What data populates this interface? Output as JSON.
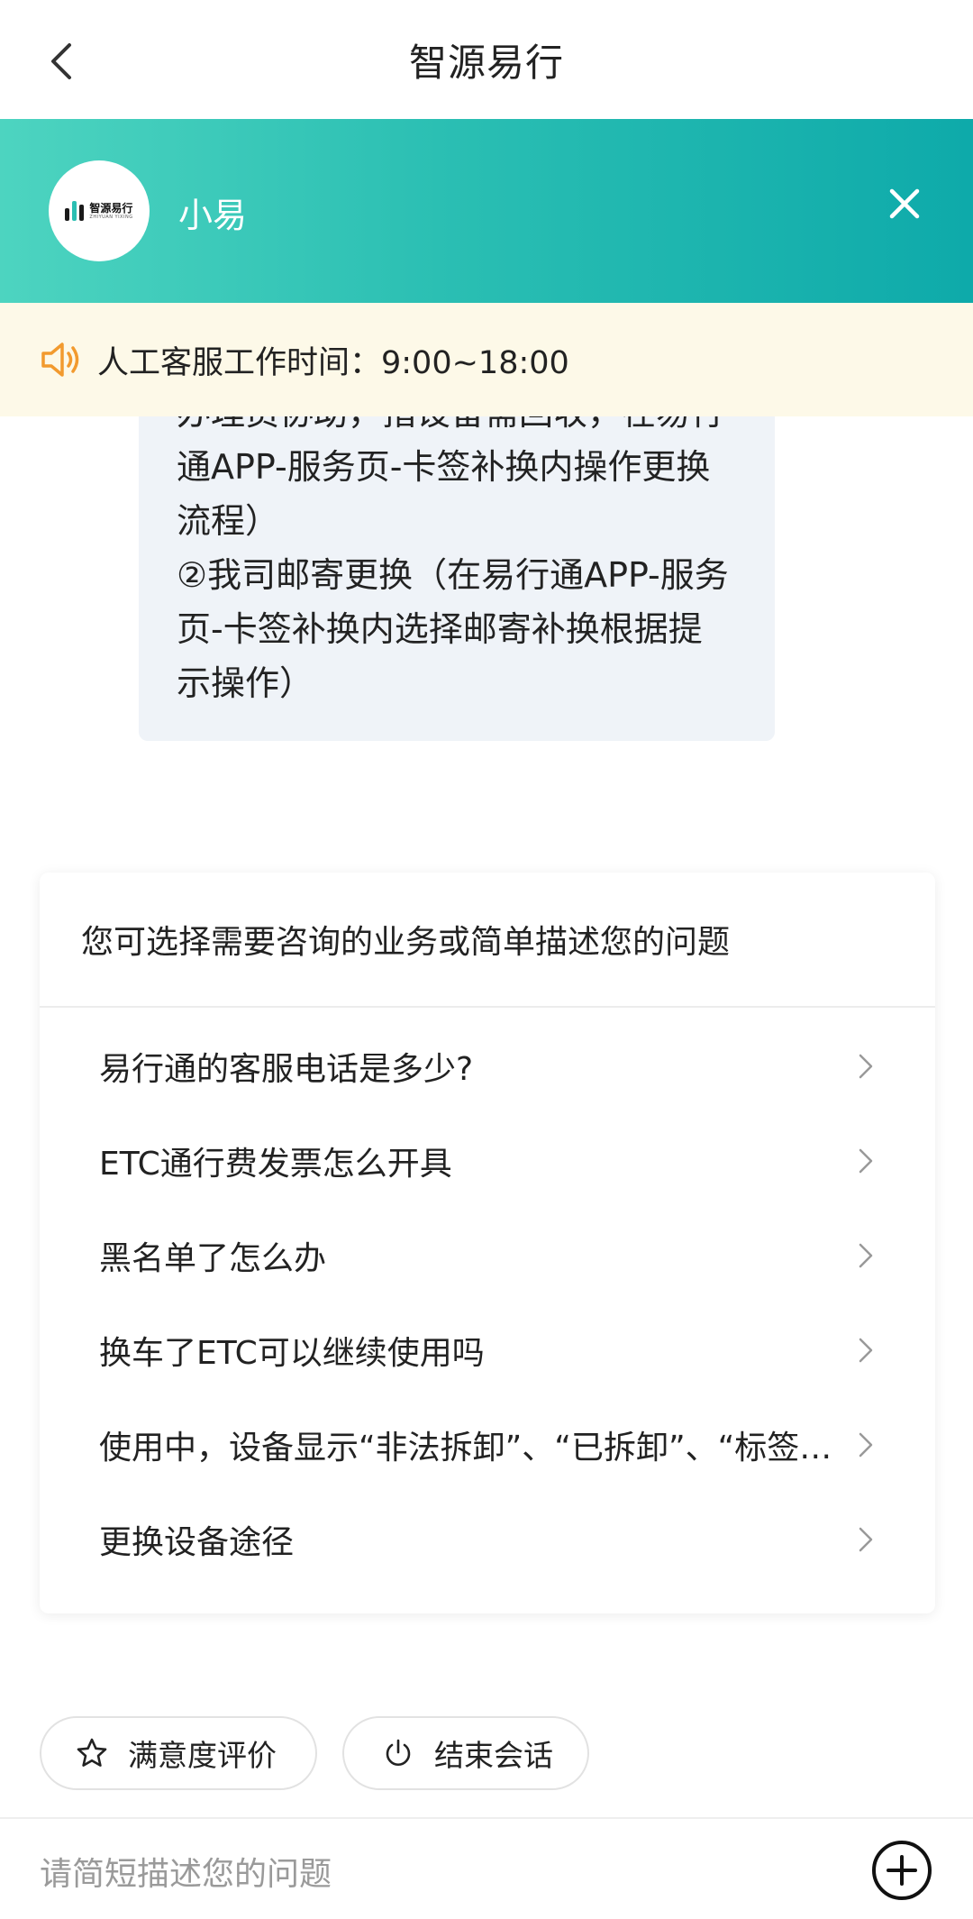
{
  "header": {
    "title": "智源易行"
  },
  "agent": {
    "name": "小易",
    "logo_text": "智源易行",
    "logo_subtext": "ZHIYUAN YIXING"
  },
  "notice": {
    "text": "人工客服工作时间：9:00~18:00"
  },
  "message": {
    "lines": [
      "办理员协助，指设备需回收，在易行",
      "通APP-服务页-卡签补换内操作更换",
      "流程）",
      "②我司邮寄更换（在易行通APP-服务",
      "页-卡签补换内选择邮寄补换根据提",
      "示操作）"
    ]
  },
  "faq": {
    "header": "您可选择需要咨询的业务或简单描述您的问题",
    "items": [
      {
        "label": "易行通的客服电话是多少?"
      },
      {
        "label": "ETC通行费发票怎么开具"
      },
      {
        "label": "黑名单了怎么办"
      },
      {
        "label": "换车了ETC可以继续使用吗"
      },
      {
        "label": "使用中，设备显示“非法拆卸”、“已拆卸”、“标签…"
      },
      {
        "label": "更换设备途径"
      }
    ]
  },
  "actions": {
    "rate_label": "满意度评价",
    "end_label": "结束会话"
  },
  "input": {
    "placeholder": "请简短描述您的问题",
    "value": ""
  },
  "icons": {
    "back": "chevron-left-icon",
    "close": "close-icon",
    "speaker": "speaker-icon",
    "chevron": "chevron-right-icon",
    "star": "star-icon",
    "power": "power-icon",
    "plus": "plus-circle-icon"
  },
  "colors": {
    "banner_start": "#4dd4c0",
    "banner_end": "#0eaaaa",
    "notice_bg": "#fdf9e8",
    "speaker": "#f29a2e",
    "bubble_bg": "#eff3f8"
  }
}
